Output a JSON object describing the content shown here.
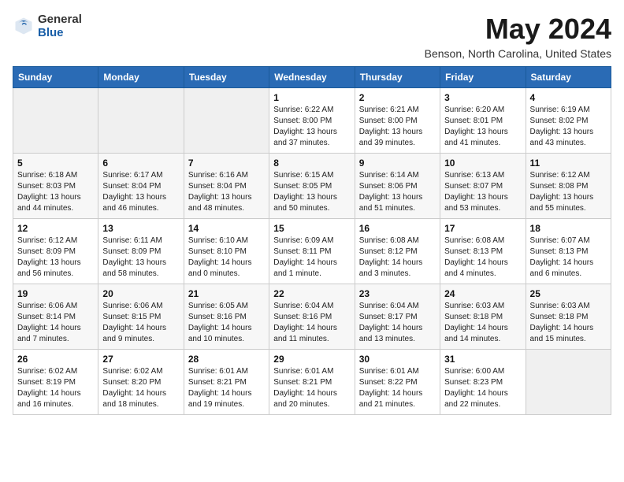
{
  "app": {
    "name_general": "General",
    "name_blue": "Blue",
    "month_title": "May 2024",
    "location": "Benson, North Carolina, United States"
  },
  "calendar": {
    "headers": [
      "Sunday",
      "Monday",
      "Tuesday",
      "Wednesday",
      "Thursday",
      "Friday",
      "Saturday"
    ],
    "weeks": [
      [
        {
          "day": "",
          "info": ""
        },
        {
          "day": "",
          "info": ""
        },
        {
          "day": "",
          "info": ""
        },
        {
          "day": "1",
          "info": "Sunrise: 6:22 AM\nSunset: 8:00 PM\nDaylight: 13 hours and 37 minutes."
        },
        {
          "day": "2",
          "info": "Sunrise: 6:21 AM\nSunset: 8:00 PM\nDaylight: 13 hours and 39 minutes."
        },
        {
          "day": "3",
          "info": "Sunrise: 6:20 AM\nSunset: 8:01 PM\nDaylight: 13 hours and 41 minutes."
        },
        {
          "day": "4",
          "info": "Sunrise: 6:19 AM\nSunset: 8:02 PM\nDaylight: 13 hours and 43 minutes."
        }
      ],
      [
        {
          "day": "5",
          "info": "Sunrise: 6:18 AM\nSunset: 8:03 PM\nDaylight: 13 hours and 44 minutes."
        },
        {
          "day": "6",
          "info": "Sunrise: 6:17 AM\nSunset: 8:04 PM\nDaylight: 13 hours and 46 minutes."
        },
        {
          "day": "7",
          "info": "Sunrise: 6:16 AM\nSunset: 8:04 PM\nDaylight: 13 hours and 48 minutes."
        },
        {
          "day": "8",
          "info": "Sunrise: 6:15 AM\nSunset: 8:05 PM\nDaylight: 13 hours and 50 minutes."
        },
        {
          "day": "9",
          "info": "Sunrise: 6:14 AM\nSunset: 8:06 PM\nDaylight: 13 hours and 51 minutes."
        },
        {
          "day": "10",
          "info": "Sunrise: 6:13 AM\nSunset: 8:07 PM\nDaylight: 13 hours and 53 minutes."
        },
        {
          "day": "11",
          "info": "Sunrise: 6:12 AM\nSunset: 8:08 PM\nDaylight: 13 hours and 55 minutes."
        }
      ],
      [
        {
          "day": "12",
          "info": "Sunrise: 6:12 AM\nSunset: 8:09 PM\nDaylight: 13 hours and 56 minutes."
        },
        {
          "day": "13",
          "info": "Sunrise: 6:11 AM\nSunset: 8:09 PM\nDaylight: 13 hours and 58 minutes."
        },
        {
          "day": "14",
          "info": "Sunrise: 6:10 AM\nSunset: 8:10 PM\nDaylight: 14 hours and 0 minutes."
        },
        {
          "day": "15",
          "info": "Sunrise: 6:09 AM\nSunset: 8:11 PM\nDaylight: 14 hours and 1 minute."
        },
        {
          "day": "16",
          "info": "Sunrise: 6:08 AM\nSunset: 8:12 PM\nDaylight: 14 hours and 3 minutes."
        },
        {
          "day": "17",
          "info": "Sunrise: 6:08 AM\nSunset: 8:13 PM\nDaylight: 14 hours and 4 minutes."
        },
        {
          "day": "18",
          "info": "Sunrise: 6:07 AM\nSunset: 8:13 PM\nDaylight: 14 hours and 6 minutes."
        }
      ],
      [
        {
          "day": "19",
          "info": "Sunrise: 6:06 AM\nSunset: 8:14 PM\nDaylight: 14 hours and 7 minutes."
        },
        {
          "day": "20",
          "info": "Sunrise: 6:06 AM\nSunset: 8:15 PM\nDaylight: 14 hours and 9 minutes."
        },
        {
          "day": "21",
          "info": "Sunrise: 6:05 AM\nSunset: 8:16 PM\nDaylight: 14 hours and 10 minutes."
        },
        {
          "day": "22",
          "info": "Sunrise: 6:04 AM\nSunset: 8:16 PM\nDaylight: 14 hours and 11 minutes."
        },
        {
          "day": "23",
          "info": "Sunrise: 6:04 AM\nSunset: 8:17 PM\nDaylight: 14 hours and 13 minutes."
        },
        {
          "day": "24",
          "info": "Sunrise: 6:03 AM\nSunset: 8:18 PM\nDaylight: 14 hours and 14 minutes."
        },
        {
          "day": "25",
          "info": "Sunrise: 6:03 AM\nSunset: 8:18 PM\nDaylight: 14 hours and 15 minutes."
        }
      ],
      [
        {
          "day": "26",
          "info": "Sunrise: 6:02 AM\nSunset: 8:19 PM\nDaylight: 14 hours and 16 minutes."
        },
        {
          "day": "27",
          "info": "Sunrise: 6:02 AM\nSunset: 8:20 PM\nDaylight: 14 hours and 18 minutes."
        },
        {
          "day": "28",
          "info": "Sunrise: 6:01 AM\nSunset: 8:21 PM\nDaylight: 14 hours and 19 minutes."
        },
        {
          "day": "29",
          "info": "Sunrise: 6:01 AM\nSunset: 8:21 PM\nDaylight: 14 hours and 20 minutes."
        },
        {
          "day": "30",
          "info": "Sunrise: 6:01 AM\nSunset: 8:22 PM\nDaylight: 14 hours and 21 minutes."
        },
        {
          "day": "31",
          "info": "Sunrise: 6:00 AM\nSunset: 8:23 PM\nDaylight: 14 hours and 22 minutes."
        },
        {
          "day": "",
          "info": ""
        }
      ]
    ]
  }
}
